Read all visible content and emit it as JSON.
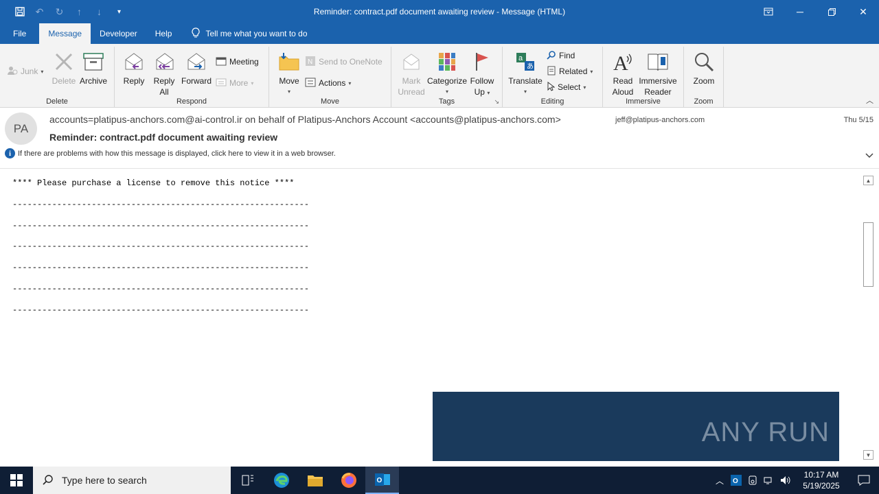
{
  "window": {
    "title": "Reminder: contract.pdf document awaiting review  -  Message (HTML)"
  },
  "menu": {
    "tabs": [
      "File",
      "Message",
      "Developer",
      "Help"
    ],
    "active_tab": "Message",
    "tell_me": "Tell me what you want to do"
  },
  "ribbon": {
    "delete_group": {
      "label": "Delete",
      "junk": "Junk",
      "delete": "Delete",
      "archive": "Archive"
    },
    "respond_group": {
      "label": "Respond",
      "reply": "Reply",
      "reply_all_1": "Reply",
      "reply_all_2": "All",
      "forward": "Forward",
      "meeting": "Meeting",
      "more": "More"
    },
    "move_group": {
      "label": "Move",
      "move": "Move",
      "send_onenote": "Send to OneNote",
      "actions": "Actions"
    },
    "tags_group": {
      "label": "Tags",
      "mark_unread_1": "Mark",
      "mark_unread_2": "Unread",
      "categorize": "Categorize",
      "follow_up_1": "Follow",
      "follow_up_2": "Up"
    },
    "editing_group": {
      "label": "Editing",
      "translate": "Translate",
      "find": "Find",
      "related": "Related",
      "select": "Select"
    },
    "immersive_group": {
      "label": "Immersive",
      "read_aloud_1": "Read",
      "read_aloud_2": "Aloud",
      "immersive_reader_1": "Immersive",
      "immersive_reader_2": "Reader"
    },
    "zoom_group": {
      "label": "Zoom",
      "zoom": "Zoom"
    }
  },
  "message": {
    "avatar_initials": "PA",
    "from": "accounts=platipus-anchors.com@ai-control.ir on behalf of Platipus-Anchors Account <accounts@platipus-anchors.com>",
    "to": "jeff@platipus-anchors.com",
    "date": "Thu 5/15",
    "subject": "Reminder: contract.pdf document awaiting review",
    "info": "If there are problems with how this message is displayed, click here to view it in a web browser."
  },
  "body": {
    "notice": "**** Please purchase a license to remove this notice ****",
    "separator": "------------------------------------------------------------",
    "separator_count": 6
  },
  "watermark": {
    "text": "ANY RUN"
  },
  "taskbar": {
    "search_placeholder": "Type here to search",
    "time": "10:17 AM",
    "date": "5/19/2025"
  }
}
